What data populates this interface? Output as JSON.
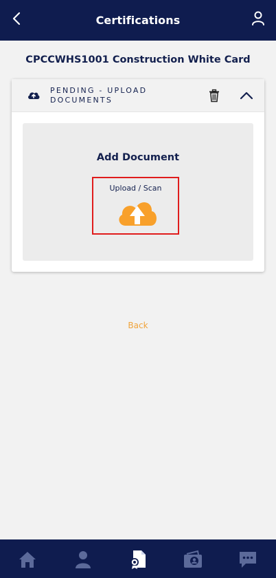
{
  "header": {
    "title": "Certifications",
    "back_icon": "chevron-left-icon",
    "profile_icon": "user-icon"
  },
  "course": {
    "title": "CPCCWHS1001 Construction White Card"
  },
  "card": {
    "status_line1": "PENDING - UPLOAD",
    "status_line2": "DOCUMENTS",
    "status_icon": "cloud-upload-icon",
    "delete_icon": "trash-icon",
    "collapse_icon": "chevron-up-icon",
    "add_document_title": "Add Document",
    "upload_label": "Upload / Scan",
    "upload_icon": "cloud-upload-icon"
  },
  "back_link": "Back",
  "bottom_nav": {
    "items": [
      {
        "icon": "home-icon",
        "active": false
      },
      {
        "icon": "profile-icon",
        "active": false
      },
      {
        "icon": "certificate-document-icon",
        "active": true
      },
      {
        "icon": "wallet-card-icon",
        "active": false
      },
      {
        "icon": "chat-icon",
        "active": false
      }
    ]
  },
  "colors": {
    "primary_navy": "#0f1c4f",
    "accent_orange": "#f8a02b",
    "highlight_red": "#e01b1b",
    "nav_inactive": "#5c6a9a",
    "nav_active": "#ffffff"
  }
}
